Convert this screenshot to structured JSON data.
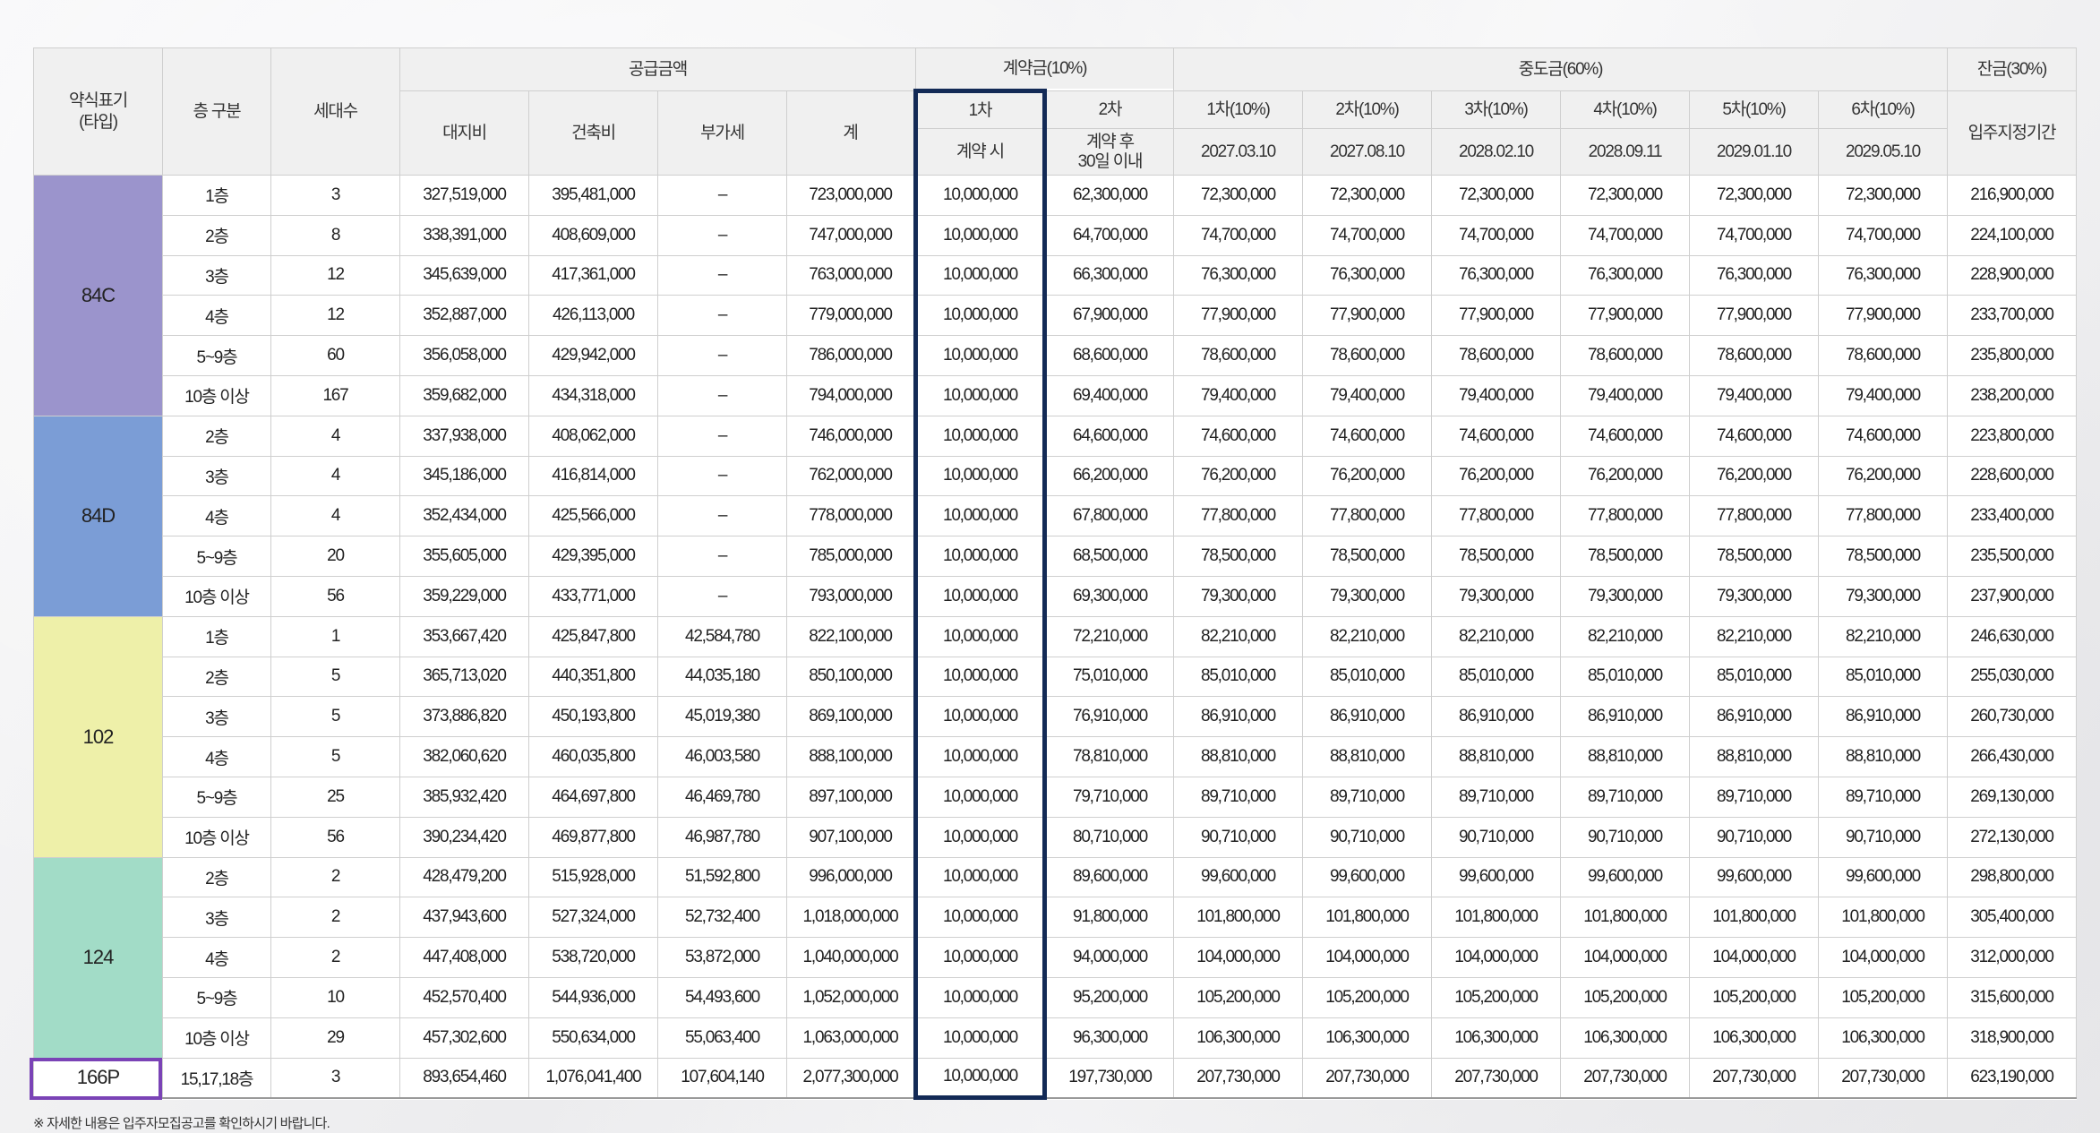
{
  "header": {
    "type_label": "약식표기\n(타입)",
    "floor_label": "층 구분",
    "units_label": "세대수",
    "supply_label": "공급금액",
    "supply_cols": [
      "대지비",
      "건축비",
      "부가세",
      "계"
    ],
    "deposit_label": "계약금(10%)",
    "deposit_cols": [
      {
        "top": "1차",
        "bottom": "계약 시"
      },
      {
        "top": "2차",
        "bottom": "계약 후\n30일 이내"
      }
    ],
    "middle_label": "중도금(60%)",
    "middle_cols": [
      {
        "top": "1차(10%)",
        "bottom": "2027.03.10"
      },
      {
        "top": "2차(10%)",
        "bottom": "2027.08.10"
      },
      {
        "top": "3차(10%)",
        "bottom": "2028.02.10"
      },
      {
        "top": "4차(10%)",
        "bottom": "2028.09.11"
      },
      {
        "top": "5차(10%)",
        "bottom": "2029.01.10"
      },
      {
        "top": "6차(10%)",
        "bottom": "2029.05.10"
      }
    ],
    "balance_label": "잔금(30%)",
    "balance_sub": "입주지정기간"
  },
  "groups": [
    {
      "type": "84C",
      "color": "#9b94cc",
      "rows": [
        {
          "floor": "1층",
          "units": "3",
          "land": "327,519,000",
          "build": "395,481,000",
          "vat": "–",
          "total": "723,000,000",
          "dep1": "10,000,000",
          "dep2": "62,300,000",
          "mid": "72,300,000",
          "bal": "216,900,000"
        },
        {
          "floor": "2층",
          "units": "8",
          "land": "338,391,000",
          "build": "408,609,000",
          "vat": "–",
          "total": "747,000,000",
          "dep1": "10,000,000",
          "dep2": "64,700,000",
          "mid": "74,700,000",
          "bal": "224,100,000"
        },
        {
          "floor": "3층",
          "units": "12",
          "land": "345,639,000",
          "build": "417,361,000",
          "vat": "–",
          "total": "763,000,000",
          "dep1": "10,000,000",
          "dep2": "66,300,000",
          "mid": "76,300,000",
          "bal": "228,900,000"
        },
        {
          "floor": "4층",
          "units": "12",
          "land": "352,887,000",
          "build": "426,113,000",
          "vat": "–",
          "total": "779,000,000",
          "dep1": "10,000,000",
          "dep2": "67,900,000",
          "mid": "77,900,000",
          "bal": "233,700,000"
        },
        {
          "floor": "5~9층",
          "units": "60",
          "land": "356,058,000",
          "build": "429,942,000",
          "vat": "–",
          "total": "786,000,000",
          "dep1": "10,000,000",
          "dep2": "68,600,000",
          "mid": "78,600,000",
          "bal": "235,800,000"
        },
        {
          "floor": "10층 이상",
          "units": "167",
          "land": "359,682,000",
          "build": "434,318,000",
          "vat": "–",
          "total": "794,000,000",
          "dep1": "10,000,000",
          "dep2": "69,400,000",
          "mid": "79,400,000",
          "bal": "238,200,000"
        }
      ]
    },
    {
      "type": "84D",
      "color": "#7b9dd6",
      "rows": [
        {
          "floor": "2층",
          "units": "4",
          "land": "337,938,000",
          "build": "408,062,000",
          "vat": "–",
          "total": "746,000,000",
          "dep1": "10,000,000",
          "dep2": "64,600,000",
          "mid": "74,600,000",
          "bal": "223,800,000"
        },
        {
          "floor": "3층",
          "units": "4",
          "land": "345,186,000",
          "build": "416,814,000",
          "vat": "–",
          "total": "762,000,000",
          "dep1": "10,000,000",
          "dep2": "66,200,000",
          "mid": "76,200,000",
          "bal": "228,600,000"
        },
        {
          "floor": "4층",
          "units": "4",
          "land": "352,434,000",
          "build": "425,566,000",
          "vat": "–",
          "total": "778,000,000",
          "dep1": "10,000,000",
          "dep2": "67,800,000",
          "mid": "77,800,000",
          "bal": "233,400,000"
        },
        {
          "floor": "5~9층",
          "units": "20",
          "land": "355,605,000",
          "build": "429,395,000",
          "vat": "–",
          "total": "785,000,000",
          "dep1": "10,000,000",
          "dep2": "68,500,000",
          "mid": "78,500,000",
          "bal": "235,500,000"
        },
        {
          "floor": "10층 이상",
          "units": "56",
          "land": "359,229,000",
          "build": "433,771,000",
          "vat": "–",
          "total": "793,000,000",
          "dep1": "10,000,000",
          "dep2": "69,300,000",
          "mid": "79,300,000",
          "bal": "237,900,000"
        }
      ]
    },
    {
      "type": "102",
      "color": "#eef0a9",
      "rows": [
        {
          "floor": "1층",
          "units": "1",
          "land": "353,667,420",
          "build": "425,847,800",
          "vat": "42,584,780",
          "total": "822,100,000",
          "dep1": "10,000,000",
          "dep2": "72,210,000",
          "mid": "82,210,000",
          "bal": "246,630,000"
        },
        {
          "floor": "2층",
          "units": "5",
          "land": "365,713,020",
          "build": "440,351,800",
          "vat": "44,035,180",
          "total": "850,100,000",
          "dep1": "10,000,000",
          "dep2": "75,010,000",
          "mid": "85,010,000",
          "bal": "255,030,000"
        },
        {
          "floor": "3층",
          "units": "5",
          "land": "373,886,820",
          "build": "450,193,800",
          "vat": "45,019,380",
          "total": "869,100,000",
          "dep1": "10,000,000",
          "dep2": "76,910,000",
          "mid": "86,910,000",
          "bal": "260,730,000"
        },
        {
          "floor": "4층",
          "units": "5",
          "land": "382,060,620",
          "build": "460,035,800",
          "vat": "46,003,580",
          "total": "888,100,000",
          "dep1": "10,000,000",
          "dep2": "78,810,000",
          "mid": "88,810,000",
          "bal": "266,430,000"
        },
        {
          "floor": "5~9층",
          "units": "25",
          "land": "385,932,420",
          "build": "464,697,800",
          "vat": "46,469,780",
          "total": "897,100,000",
          "dep1": "10,000,000",
          "dep2": "79,710,000",
          "mid": "89,710,000",
          "bal": "269,130,000"
        },
        {
          "floor": "10층 이상",
          "units": "56",
          "land": "390,234,420",
          "build": "469,877,800",
          "vat": "46,987,780",
          "total": "907,100,000",
          "dep1": "10,000,000",
          "dep2": "80,710,000",
          "mid": "90,710,000",
          "bal": "272,130,000"
        }
      ]
    },
    {
      "type": "124",
      "color": "#a2dcc7",
      "rows": [
        {
          "floor": "2층",
          "units": "2",
          "land": "428,479,200",
          "build": "515,928,000",
          "vat": "51,592,800",
          "total": "996,000,000",
          "dep1": "10,000,000",
          "dep2": "89,600,000",
          "mid": "99,600,000",
          "bal": "298,800,000"
        },
        {
          "floor": "3층",
          "units": "2",
          "land": "437,943,600",
          "build": "527,324,000",
          "vat": "52,732,400",
          "total": "1,018,000,000",
          "dep1": "10,000,000",
          "dep2": "91,800,000",
          "mid": "101,800,000",
          "bal": "305,400,000"
        },
        {
          "floor": "4층",
          "units": "2",
          "land": "447,408,000",
          "build": "538,720,000",
          "vat": "53,872,000",
          "total": "1,040,000,000",
          "dep1": "10,000,000",
          "dep2": "94,000,000",
          "mid": "104,000,000",
          "bal": "312,000,000"
        },
        {
          "floor": "5~9층",
          "units": "10",
          "land": "452,570,400",
          "build": "544,936,000",
          "vat": "54,493,600",
          "total": "1,052,000,000",
          "dep1": "10,000,000",
          "dep2": "95,200,000",
          "mid": "105,200,000",
          "bal": "315,600,000"
        },
        {
          "floor": "10층 이상",
          "units": "29",
          "land": "457,302,600",
          "build": "550,634,000",
          "vat": "55,063,400",
          "total": "1,063,000,000",
          "dep1": "10,000,000",
          "dep2": "96,300,000",
          "mid": "106,300,000",
          "bal": "318,900,000"
        }
      ]
    },
    {
      "type": "166P",
      "color": "#ffffff",
      "rows": [
        {
          "floor": "15,17,18층",
          "units": "3",
          "land": "893,654,460",
          "build": "1,076,041,400",
          "vat": "107,604,140",
          "total": "2,077,300,000",
          "dep1": "10,000,000",
          "dep2": "197,730,000",
          "mid": "207,730,000",
          "bal": "623,190,000"
        }
      ]
    }
  ],
  "footnote": "※ 자세한 내용은 입주자모집공고를 확인하시기 바랍니다."
}
